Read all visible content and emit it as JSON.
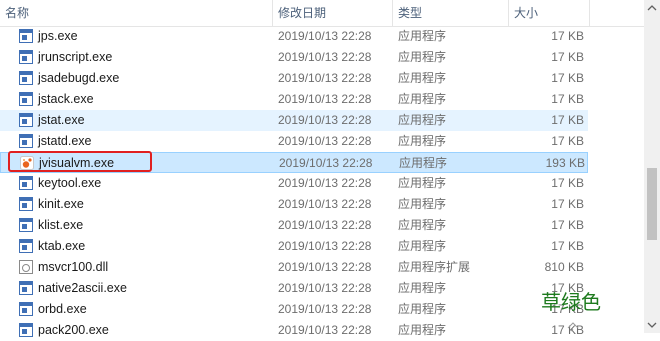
{
  "columns": {
    "name": "名称",
    "date": "修改日期",
    "type": "类型",
    "size": "大小"
  },
  "files": [
    {
      "name": "jps.exe",
      "date": "2019/10/13 22:28",
      "type": "应用程序",
      "size": "17 KB",
      "icon": "exe-icon"
    },
    {
      "name": "jrunscript.exe",
      "date": "2019/10/13 22:28",
      "type": "应用程序",
      "size": "17 KB",
      "icon": "exe-icon"
    },
    {
      "name": "jsadebugd.exe",
      "date": "2019/10/13 22:28",
      "type": "应用程序",
      "size": "17 KB",
      "icon": "exe-icon"
    },
    {
      "name": "jstack.exe",
      "date": "2019/10/13 22:28",
      "type": "应用程序",
      "size": "17 KB",
      "icon": "exe-icon"
    },
    {
      "name": "jstat.exe",
      "date": "2019/10/13 22:28",
      "type": "应用程序",
      "size": "17 KB",
      "icon": "exe-icon",
      "state": "hover"
    },
    {
      "name": "jstatd.exe",
      "date": "2019/10/13 22:28",
      "type": "应用程序",
      "size": "17 KB",
      "icon": "exe-icon"
    },
    {
      "name": "jvisualvm.exe",
      "date": "2019/10/13 22:28",
      "type": "应用程序",
      "size": "193 KB",
      "icon": "visualvm-icon",
      "state": "selected",
      "highlighted": true
    },
    {
      "name": "keytool.exe",
      "date": "2019/10/13 22:28",
      "type": "应用程序",
      "size": "17 KB",
      "icon": "exe-icon"
    },
    {
      "name": "kinit.exe",
      "date": "2019/10/13 22:28",
      "type": "应用程序",
      "size": "17 KB",
      "icon": "exe-icon"
    },
    {
      "name": "klist.exe",
      "date": "2019/10/13 22:28",
      "type": "应用程序",
      "size": "17 KB",
      "icon": "exe-icon"
    },
    {
      "name": "ktab.exe",
      "date": "2019/10/13 22:28",
      "type": "应用程序",
      "size": "17 KB",
      "icon": "exe-icon"
    },
    {
      "name": "msvcr100.dll",
      "date": "2019/10/13 22:28",
      "type": "应用程序扩展",
      "size": "810 KB",
      "icon": "dll-icon"
    },
    {
      "name": "native2ascii.exe",
      "date": "2019/10/13 22:28",
      "type": "应用程序",
      "size": "17 KB",
      "icon": "exe-icon"
    },
    {
      "name": "orbd.exe",
      "date": "2019/10/13 22:28",
      "type": "应用程序",
      "size": "17 KB",
      "icon": "exe-icon"
    },
    {
      "name": "pack200.exe",
      "date": "2019/10/13 22:28",
      "type": "应用程序",
      "size": "17 KB",
      "icon": "exe-icon"
    }
  ],
  "watermark": "草绿色",
  "colors": {
    "selected_bg": "#cce8ff",
    "hover_bg": "#e5f3ff",
    "highlight_border": "#e02020",
    "watermark": "#1e7a1e"
  }
}
